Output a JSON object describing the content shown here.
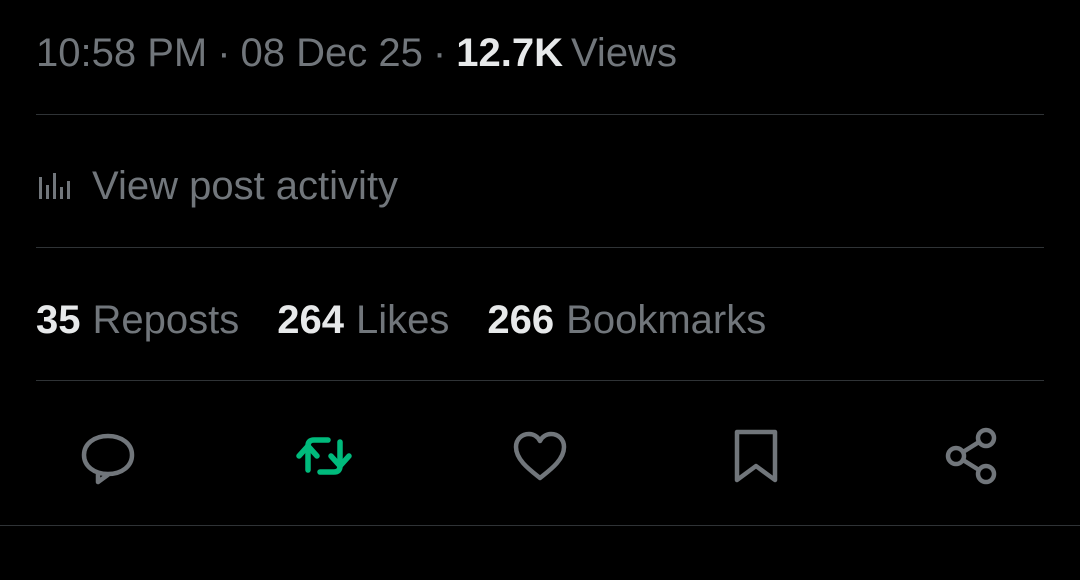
{
  "meta": {
    "time": "10:58 PM",
    "separator": "·",
    "date": "08 Dec 25",
    "views_count": "12.7K",
    "views_label": "Views"
  },
  "activity": {
    "label": "View post activity",
    "icon": "bar-chart-icon"
  },
  "stats": [
    {
      "count": "35",
      "label": "Reposts"
    },
    {
      "count": "264",
      "label": "Likes"
    },
    {
      "count": "266",
      "label": "Bookmarks"
    }
  ],
  "actions": [
    {
      "icon": "reply-icon"
    },
    {
      "icon": "repost-icon",
      "active": true,
      "color": "#00ba7c"
    },
    {
      "icon": "like-icon"
    },
    {
      "icon": "bookmark-icon"
    },
    {
      "icon": "share-icon"
    }
  ],
  "colors": {
    "background": "#000000",
    "primary_text": "#e7e9ea",
    "secondary_text": "#71767b",
    "divider": "#2f3336",
    "repost_active": "#00ba7c"
  }
}
